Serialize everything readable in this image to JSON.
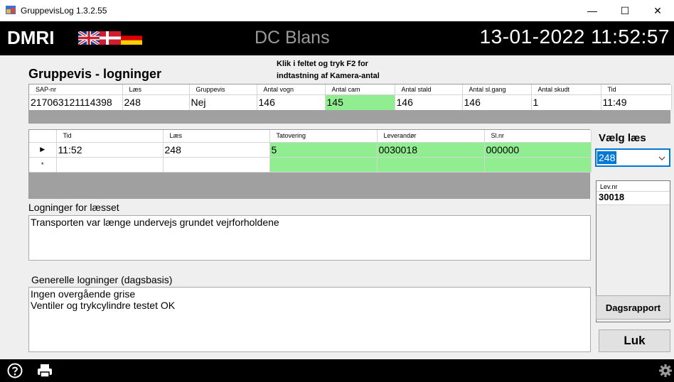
{
  "window": {
    "title": "GruppevisLog 1.3.2.55",
    "minimize": "—",
    "maximize": "☐",
    "close": "✕"
  },
  "header": {
    "logo": "DMRI",
    "flags": [
      "uk-flag",
      "denmark-flag",
      "germany-flag"
    ],
    "site": "DC Blans",
    "datetime": "13-01-2022 11:52:57"
  },
  "main": {
    "heading": "Gruppevis - logninger",
    "hint_line1": "Klik i feltet og tryk F2 for",
    "hint_line2": "indtastning af Kamera-antal"
  },
  "summary": {
    "columns": [
      "SAP-nr",
      "Læs",
      "Gruppevis",
      "Antal vogn",
      "Antal cam",
      "Antal stald",
      "Antal sl.gang",
      "Antal skudt",
      "Tid"
    ],
    "row": [
      "217063121114398",
      "248",
      "Nej",
      "146",
      "145",
      "146",
      "146",
      "1",
      "11:49"
    ]
  },
  "detail": {
    "columns": [
      "Tid",
      "Læs",
      "Tatovering",
      "Leverandør",
      "Sl.nr"
    ],
    "rows": [
      {
        "marker": "▶",
        "cells": [
          "11:52",
          "248",
          "5",
          "0030018",
          "000000"
        ]
      },
      {
        "marker": "*",
        "cells": [
          "",
          "",
          "",
          "",
          ""
        ]
      }
    ]
  },
  "load_log": {
    "label": "Logninger for læsset",
    "text": "Transporten var længe undervejs grundet vejrforholdene"
  },
  "general_log": {
    "label": "Generelle logninger (dagsbasis)",
    "line1": "Ingen overgående grise",
    "line2": "Ventiler og trykcylindre testet OK"
  },
  "side": {
    "choose_label": "Vælg læs",
    "selected": "248",
    "lev_header": "Lev.nr",
    "lev_value": "30018",
    "daily_report": "Dagsrapport",
    "close": "Luk"
  },
  "footer": {
    "icons": [
      "help-icon",
      "printer-icon",
      "gear-icon"
    ]
  },
  "colors": {
    "highlight_green": "#90ee90",
    "select_blue": "#0078d7",
    "header_bg": "#000000",
    "panel_bg": "#efefef"
  }
}
